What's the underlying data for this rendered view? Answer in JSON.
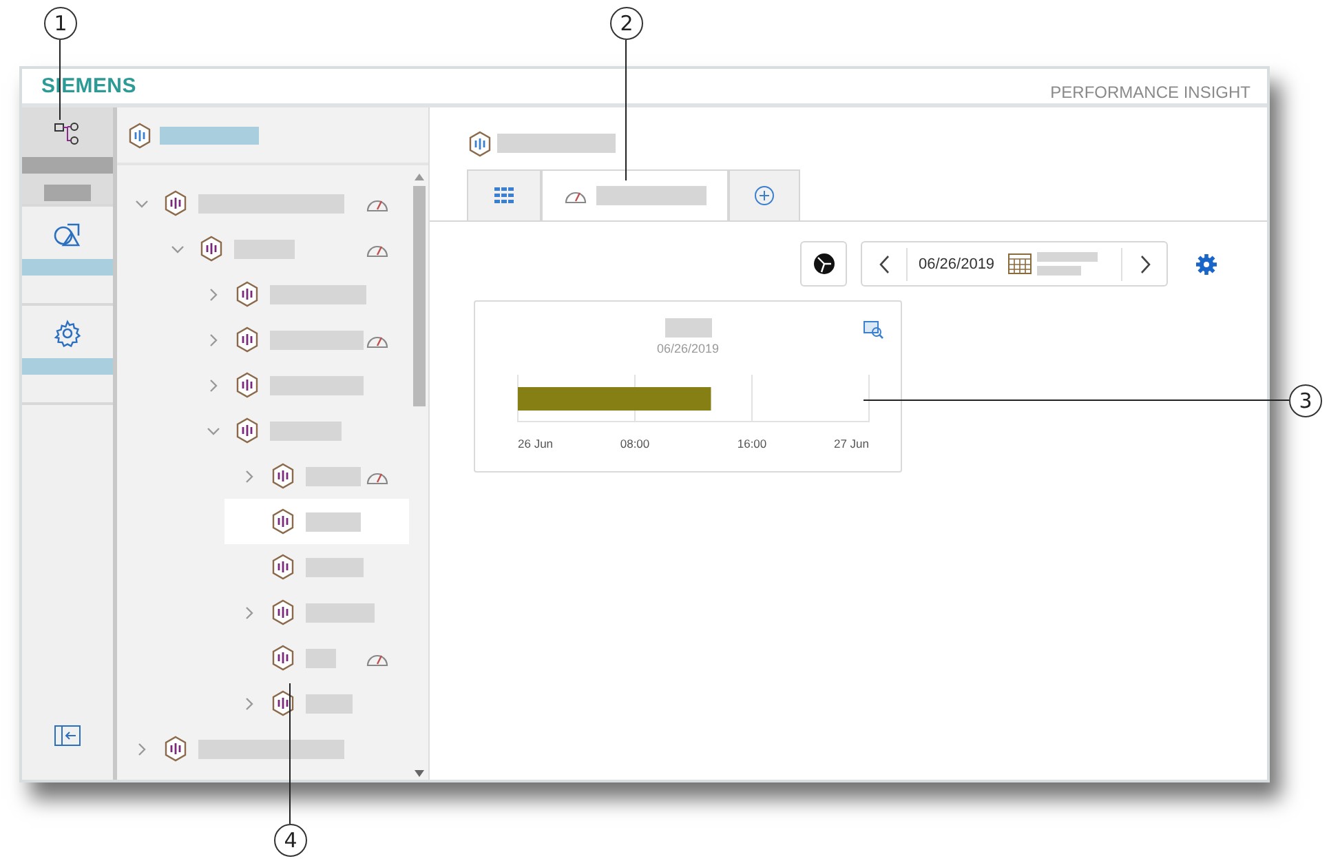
{
  "header": {
    "logo": "SIEMENS",
    "product": "PERFORMANCE INSIGHT"
  },
  "rail": [
    {
      "selected": true
    },
    {
      "selected": false
    },
    {
      "selected": false
    }
  ],
  "tree": {
    "items": [
      {
        "kind": "branch",
        "expanded": true,
        "gauge": true,
        "selected": false,
        "children": [
          {
            "kind": "branch",
            "expanded": true,
            "gauge": true,
            "selected": false,
            "children": [
              {
                "kind": "branch",
                "expanded": false,
                "gauge": false,
                "selected": false
              },
              {
                "kind": "branch",
                "expanded": false,
                "gauge": true,
                "selected": false
              },
              {
                "kind": "branch",
                "expanded": false,
                "gauge": false,
                "selected": false
              },
              {
                "kind": "branch",
                "expanded": true,
                "gauge": false,
                "selected": false,
                "children": [
                  {
                    "kind": "branch",
                    "expanded": false,
                    "gauge": true,
                    "selected": false
                  },
                  {
                    "kind": "leaf",
                    "gauge": false,
                    "selected": true
                  },
                  {
                    "kind": "leaf",
                    "gauge": false,
                    "selected": false
                  },
                  {
                    "kind": "branch",
                    "expanded": false,
                    "gauge": false,
                    "selected": false
                  },
                  {
                    "kind": "leaf",
                    "gauge": true,
                    "selected": false
                  },
                  {
                    "kind": "branch",
                    "expanded": false,
                    "gauge": false,
                    "selected": false
                  }
                ]
              }
            ]
          }
        ]
      },
      {
        "kind": "branch",
        "expanded": false,
        "gauge": false,
        "selected": false
      }
    ]
  },
  "tabs": [
    {
      "selected": false
    },
    {
      "selected": true
    },
    {
      "selected": false
    }
  ],
  "toolbar": {
    "date": "06/26/2019"
  },
  "card": {
    "date": "06/26/2019",
    "chart_data": {
      "type": "bar",
      "orientation": "horizontal",
      "series": [
        {
          "color": "#857f14",
          "values": [
            13.2
          ]
        }
      ],
      "xlim": [
        0,
        24
      ],
      "xticks": [
        {
          "value": 0,
          "label": "26 Jun"
        },
        {
          "value": 8,
          "label": "08:00"
        },
        {
          "value": 16,
          "label": "16:00"
        },
        {
          "value": 24,
          "label": "27 Jun"
        }
      ]
    }
  },
  "callouts": [
    {
      "number": "1"
    },
    {
      "number": "2"
    },
    {
      "number": "3"
    },
    {
      "number": "4"
    }
  ]
}
